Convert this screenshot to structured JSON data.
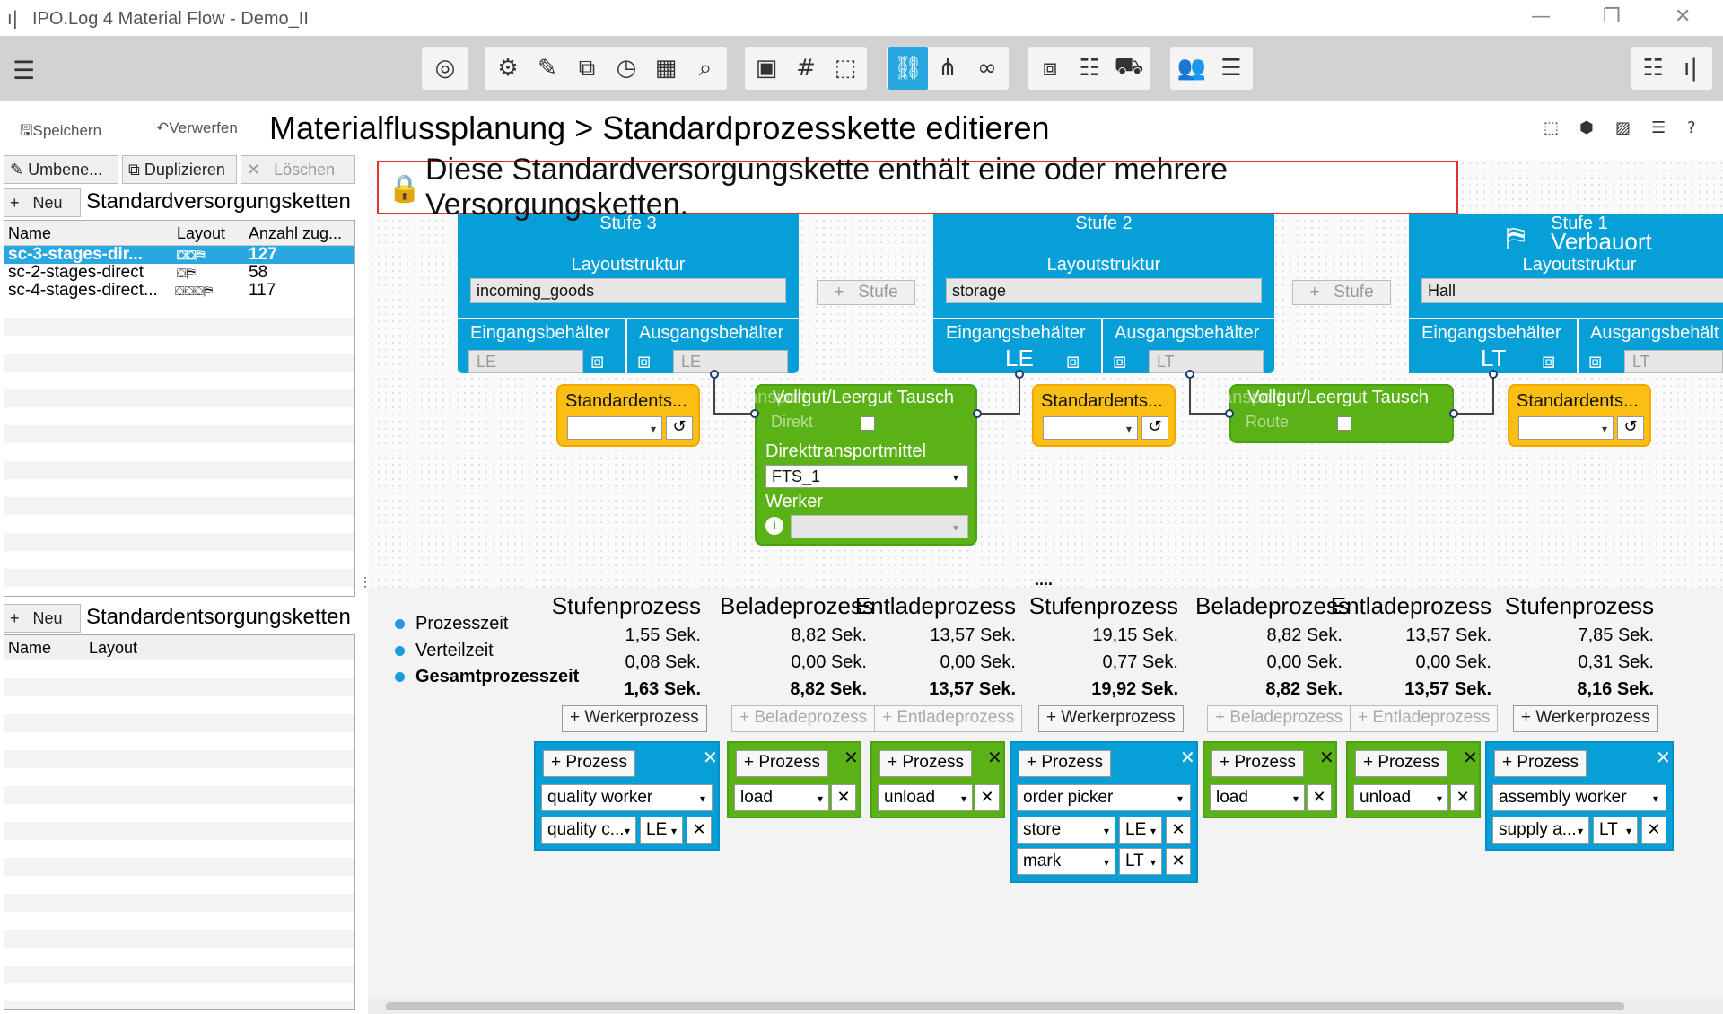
{
  "window": {
    "title": "IPO.Log 4 Material Flow - Demo_II"
  },
  "toolbar": {
    "icons": [
      "target-icon",
      "layout-icon",
      "ruler-icon",
      "layers-icon",
      "clock-icon",
      "calendar-icon",
      "search-icon",
      "frame-icon",
      "grid-icon",
      "transform-icon",
      "link-icon",
      "network-icon",
      "chain-icon",
      "boxes-icon",
      "shelf-icon",
      "forklift-icon",
      "workers-icon",
      "stack-icon"
    ],
    "active": "link-icon"
  },
  "header": {
    "save": "Speichern",
    "discard": "Verwerfen",
    "title": "Materialflussplanung > Standardprozesskette editieren"
  },
  "left": {
    "rename": "Umbene...",
    "duplicate": "Duplizieren",
    "delete": "Löschen",
    "new1": "Neu",
    "supply_title": "Standardversorgungsketten",
    "supply_cols": [
      "Name",
      "Layout",
      "Anzahl zug..."
    ],
    "supply_rows": [
      {
        "name": "sc-3-stages-dir...",
        "layout": "⛋⛋⛿",
        "count": "127"
      },
      {
        "name": "sc-2-stages-direct",
        "layout": "⛋⛿",
        "count": "58"
      },
      {
        "name": "sc-4-stages-direct...",
        "layout": "⛋⛋⛋⛿",
        "count": "117"
      }
    ],
    "new2": "Neu",
    "disposal_title": "Standardentsorgungsketten",
    "disposal_cols": [
      "Name",
      "Layout"
    ]
  },
  "alert": {
    "text": "Diese Standardversorgungskette enthält eine oder mehrere Versorgungsketten."
  },
  "stages": [
    {
      "title": "Stufe 3",
      "layout_label": "Layoutstruktur",
      "layout": "incoming_goods",
      "in_label": "Eingangsbehälter",
      "out_label": "Ausgangsbehälter",
      "in_val": "LE",
      "out_val": "LE"
    },
    {
      "title": "Stufe 2",
      "layout_label": "Layoutstruktur",
      "layout": "storage",
      "in_label": "Eingangsbehälter",
      "out_label": "Ausgangsbehälter",
      "in_big": "LE",
      "out_val": "LT"
    },
    {
      "title": "Stufe 1",
      "subtitle": "Verbauort",
      "layout_label": "Layoutstruktur",
      "layout": "Hall",
      "in_label": "Eingangsbehälter",
      "out_label": "Ausgangsbehält",
      "in_big": "LT",
      "out_val": "LT"
    }
  ],
  "stufe_btn": "Stufe",
  "disposal_box": "Standardents...",
  "transports": [
    {
      "title": "Vollgut/Leergut Tausch",
      "ghost": "Transport",
      "mode": "Direkt",
      "vehicle_label": "Direkttransportmittel",
      "vehicle": "FTS_1",
      "worker_label": "Werker"
    },
    {
      "title": "Vollgut/Leergut Tausch",
      "ghost": "Transport",
      "mode": "Route"
    }
  ],
  "legend": {
    "process": "Prozesszeit",
    "distribution": "Verteilzeit",
    "total": "Gesamtprozesszeit"
  },
  "columns": [
    {
      "head": "Stufenprozess",
      "p": "1,55 Sek.",
      "v": "0,08 Sek.",
      "t": "1,63 Sek.",
      "add": "Werkerprozess"
    },
    {
      "head": "Beladeprozess",
      "p": "8,82 Sek.",
      "v": "0,00 Sek.",
      "t": "8,82 Sek.",
      "add": "Beladeprozess"
    },
    {
      "head": "Entladeprozess",
      "p": "13,57 Sek.",
      "v": "0,00 Sek.",
      "t": "13,57 Sek.",
      "add": "Entladeprozess"
    },
    {
      "head": "Stufenprozess",
      "p": "19,15 Sek.",
      "v": "0,77 Sek.",
      "t": "19,92 Sek.",
      "add": "Werkerprozess"
    },
    {
      "head": "Beladeprozess",
      "p": "8,82 Sek.",
      "v": "0,00 Sek.",
      "t": "8,82 Sek.",
      "add": "Beladeprozess"
    },
    {
      "head": "Entladeprozess",
      "p": "13,57 Sek.",
      "v": "0,00 Sek.",
      "t": "13,57 Sek.",
      "add": "Entladeprozess"
    },
    {
      "head": "Stufenprozess",
      "p": "7,85 Sek.",
      "v": "0,31 Sek.",
      "t": "8,16 Sek.",
      "add": "Werkerprozess"
    }
  ],
  "dots": "....",
  "proc_btn": "Prozess",
  "procs": {
    "p1": {
      "worker": "quality worker",
      "task": "quality c...",
      "unit": "LE"
    },
    "p2": {
      "worker": "load"
    },
    "p3": {
      "worker": "unload"
    },
    "p4": {
      "worker": "order picker",
      "t1": "store",
      "u1": "LE",
      "t2": "mark",
      "u2": "LT"
    },
    "p5": {
      "worker": "load"
    },
    "p6": {
      "worker": "unload"
    },
    "p7": {
      "worker": "assembly worker",
      "task": "supply a...",
      "unit": "LT"
    }
  },
  "colors": {
    "blue": "#069fd8",
    "green": "#5bb217",
    "orange": "#fbbf13",
    "alert": "#dd3333"
  }
}
